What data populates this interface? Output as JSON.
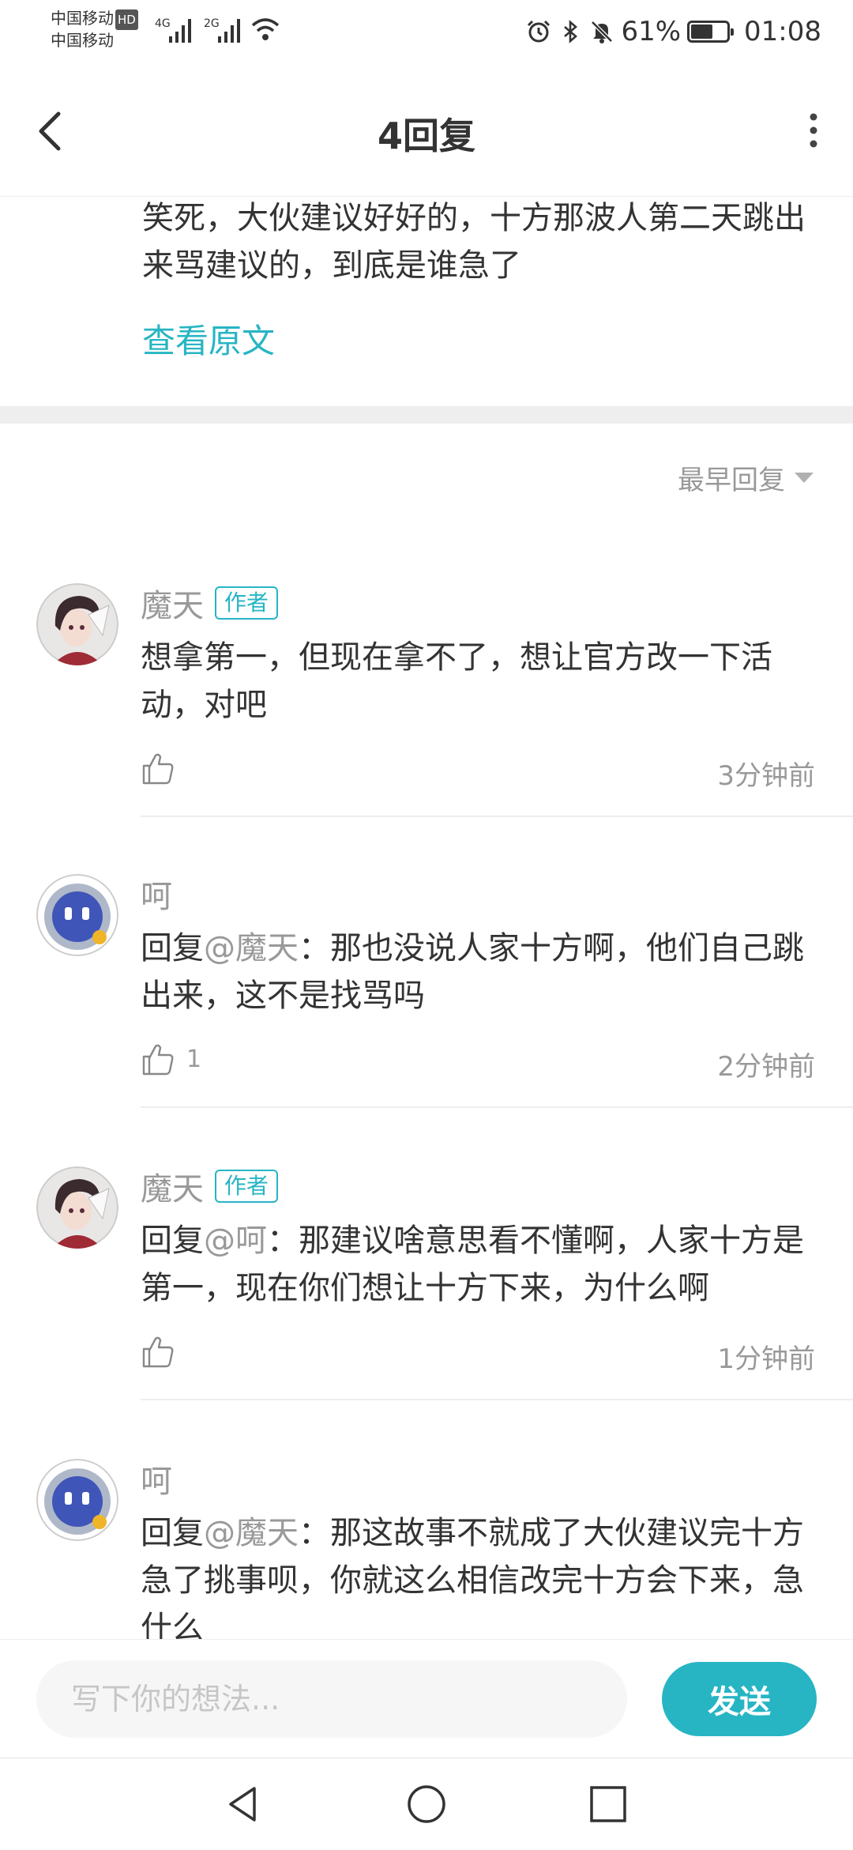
{
  "status_bar": {
    "carrier_1": "中国移动",
    "hd_badge": "HD",
    "carrier_2": "中国移动",
    "network_1": "4G",
    "network_2": "2G",
    "battery_text": "61%",
    "battery_level": 0.61,
    "time": "01:08"
  },
  "header": {
    "title": "4回复"
  },
  "original_post": {
    "text": "笑死，大伙建议好好的，十方那波人第二天跳出来骂建议的，到底是谁急了",
    "view_original_label": "查看原文"
  },
  "sort": {
    "label": "最早回复"
  },
  "comments": [
    {
      "username": "魔天",
      "badge": "作者",
      "reply_prefix": "",
      "mention": "",
      "text": "想拿第一，但现在拿不了，想让官方改一下活动，对吧",
      "like_count": "",
      "time": "3分钟前"
    },
    {
      "username": "呵",
      "badge": "",
      "reply_prefix": "回复",
      "mention": "@魔天",
      "text": "：那也没说人家十方啊，他们自己跳出来，这不是找骂吗",
      "like_count": "1",
      "time": "2分钟前"
    },
    {
      "username": "魔天",
      "badge": "作者",
      "reply_prefix": "回复",
      "mention": "@呵",
      "text": "：那建议啥意思看不懂啊，人家十方是第一，现在你们想让十方下来，为什么啊",
      "like_count": "",
      "time": "1分钟前"
    },
    {
      "username": "呵",
      "badge": "",
      "reply_prefix": "回复",
      "mention": "@魔天",
      "text": "：那这故事不就成了大伙建议完十方急了挑事呗，你就这么相信改完十方会下来，急什么"
    }
  ],
  "input_bar": {
    "placeholder": "写下你的想法...",
    "send_label": "发送"
  },
  "colors": {
    "accent": "#27b5c4",
    "muted_text": "#999999",
    "body_text": "#333333",
    "separator": "#eeeeee"
  }
}
